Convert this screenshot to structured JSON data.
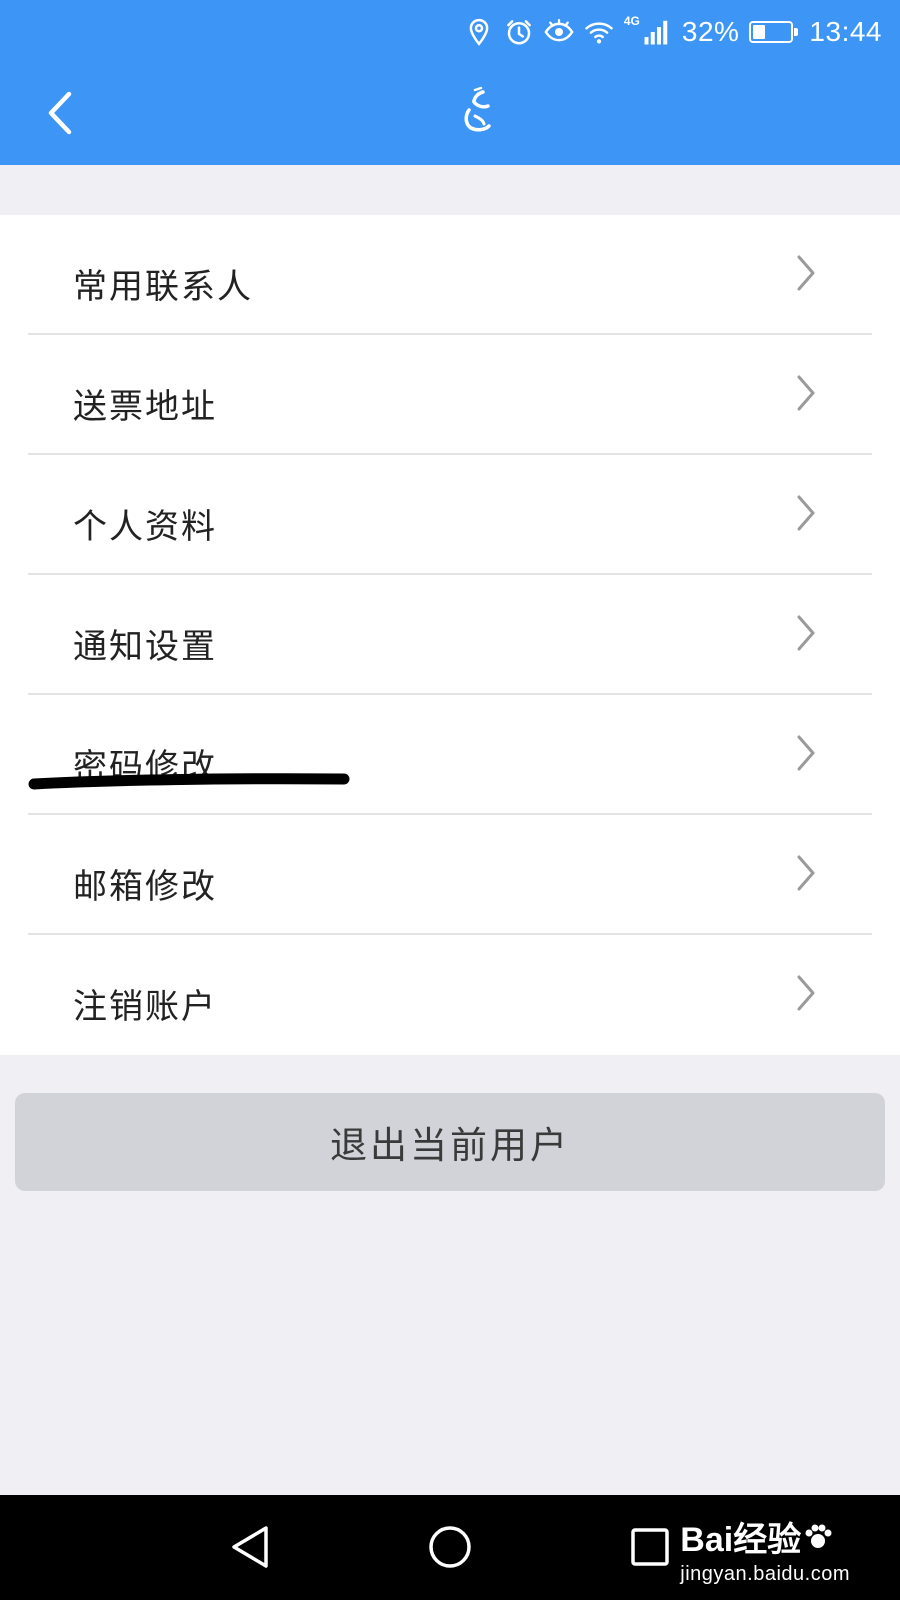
{
  "status_bar": {
    "battery_percent_text": "32%",
    "battery_level": 0.32,
    "time": "13:44",
    "network_type": "4G",
    "icons": [
      "location-icon",
      "alarm-icon",
      "eye-icon",
      "wifi-icon",
      "signal-icon",
      "battery-icon"
    ]
  },
  "header": {
    "back_icon": "chevron-left-icon",
    "logo_icon": "app-logo-icon",
    "background_color": "#3d96f5"
  },
  "menu": {
    "items": [
      {
        "label": "常用联系人"
      },
      {
        "label": "送票地址"
      },
      {
        "label": "个人资料"
      },
      {
        "label": "通知设置"
      },
      {
        "label": "密码修改"
      },
      {
        "label": "邮箱修改"
      },
      {
        "label": "注销账户"
      }
    ]
  },
  "logout": {
    "label": "退出当前用户"
  },
  "nav_bar": {
    "icons": [
      "back-triangle-icon",
      "home-circle-icon",
      "recents-square-icon"
    ]
  },
  "watermark": {
    "brand": "Bai经验",
    "url": "jingyan.baidu.com"
  }
}
